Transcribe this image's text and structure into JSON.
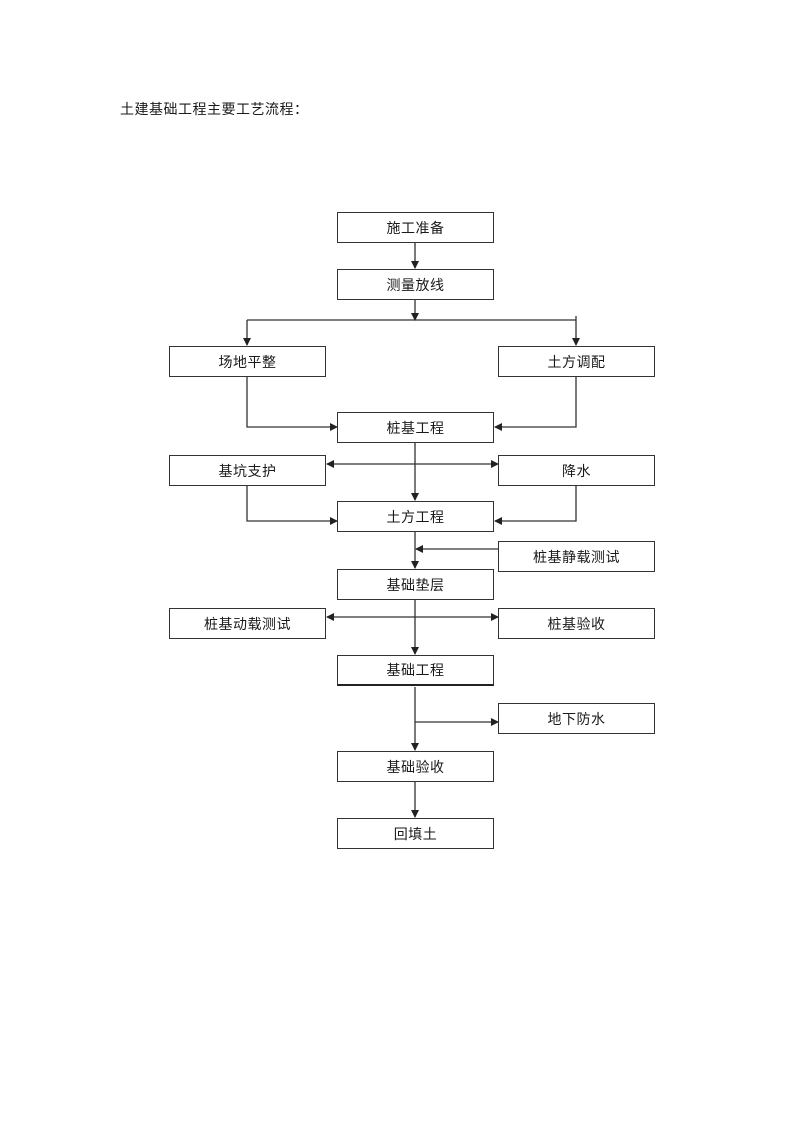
{
  "heading": "土建基础工程主要工艺流程：",
  "nodes": {
    "prep": "施工准备",
    "survey": "测量放线",
    "site_leveling": "场地平整",
    "earth_allocation": "土方调配",
    "pile_foundation": "桩基工程",
    "pit_support": "基坑支护",
    "dewatering": "降水",
    "earthwork": "土方工程",
    "pile_static_test": "桩基静载测试",
    "foundation_cushion": "基础垫层",
    "pile_dynamic_test": "桩基动载测试",
    "pile_acceptance": "桩基验收",
    "foundation_works": "基础工程",
    "underground_waterproof": "地下防水",
    "foundation_acceptance": "基础验收",
    "backfill": "回填土"
  },
  "edges": [
    [
      "prep",
      "survey"
    ],
    [
      "survey",
      "site_leveling"
    ],
    [
      "survey",
      "earth_allocation"
    ],
    [
      "site_leveling",
      "pile_foundation"
    ],
    [
      "earth_allocation",
      "pile_foundation"
    ],
    [
      "pile_foundation",
      "pit_support"
    ],
    [
      "pile_foundation",
      "dewatering"
    ],
    [
      "pile_foundation",
      "earthwork"
    ],
    [
      "pit_support",
      "earthwork"
    ],
    [
      "dewatering",
      "earthwork"
    ],
    [
      "earthwork",
      "foundation_cushion"
    ],
    [
      "pile_static_test",
      "foundation_cushion"
    ],
    [
      "foundation_cushion",
      "pile_dynamic_test"
    ],
    [
      "foundation_cushion",
      "pile_acceptance"
    ],
    [
      "foundation_cushion",
      "foundation_works"
    ],
    [
      "foundation_works",
      "underground_waterproof"
    ],
    [
      "foundation_works",
      "foundation_acceptance"
    ],
    [
      "foundation_acceptance",
      "backfill"
    ]
  ]
}
